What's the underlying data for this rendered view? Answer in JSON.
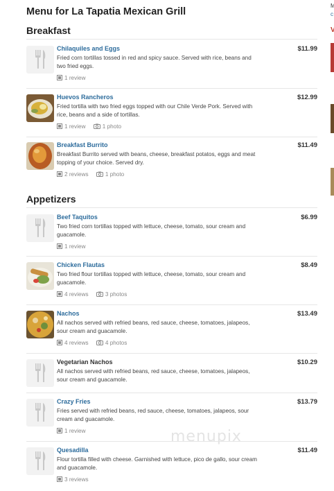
{
  "page": {
    "title": "Menu for La Tapatia Mexican Grill"
  },
  "sections": [
    {
      "title": "Breakfast",
      "items": [
        {
          "name": "Chilaquiles and Eggs",
          "price": "$11.99",
          "desc": "Fried corn tortillas tossed in red and spicy sauce. Served with rice, beans and two fried eggs.",
          "reviews": "1 review",
          "photos": ""
        },
        {
          "name": "Huevos Rancheros",
          "price": "$12.99",
          "desc": "Fried tortilla with two fried eggs topped with our Chile Verde Pork. Served with rice, beans and a side of tortillas.",
          "reviews": "1 review",
          "photos": "1 photo"
        },
        {
          "name": "Breakfast Burrito",
          "price": "$11.49",
          "desc": "Breakfast Burrito served with beans, cheese, breakfast potatos, eggs and meat topping of your choice. Served dry.",
          "reviews": "2 reviews",
          "photos": "1 photo"
        }
      ]
    },
    {
      "title": "Appetizers",
      "items": [
        {
          "name": "Beef Taquitos",
          "price": "$6.99",
          "desc": "Two fried corn tortillas topped with lettuce, cheese, tomato, sour cream and guacamole.",
          "reviews": "1 review",
          "photos": ""
        },
        {
          "name": "Chicken Flautas",
          "price": "$8.49",
          "desc": "Two fried flour tortillas topped with lettuce, cheese, tomato, sour cream and guacamole.",
          "reviews": "4 reviews",
          "photos": "3 photos"
        },
        {
          "name": "Nachos",
          "price": "$13.49",
          "desc": "All nachos served with refried beans, red sauce, cheese, tomatoes, jalapeos, sour cream and guacamole.",
          "reviews": "4 reviews",
          "photos": "4 photos"
        },
        {
          "name": "Vegetarian Nachos",
          "price": "$10.29",
          "desc": "All nachos served with refried beans, red sauce, cheese, tomatoes, jalapeos, sour cream and guacamole.",
          "reviews": "",
          "photos": ""
        },
        {
          "name": "Crazy Fries",
          "price": "$13.79",
          "desc": "Fries served with refried beans, red sauce, cheese, tomatoes, jalapeos, sour cream and guacamole.",
          "reviews": "1 review",
          "photos": ""
        },
        {
          "name": "Quesadilla",
          "price": "$11.49",
          "desc": "Flour tortilla filled with cheese. Garnished with lettuce, pico de gallo, sour cream and guacamole.",
          "reviews": "3 reviews",
          "photos": ""
        }
      ]
    }
  ],
  "watermark": "menupix",
  "sidebar": {
    "text1": "M",
    "text2": "c",
    "text3": "V"
  },
  "colors": {
    "link": "#2d6c9c",
    "accent": "#c0392b"
  }
}
